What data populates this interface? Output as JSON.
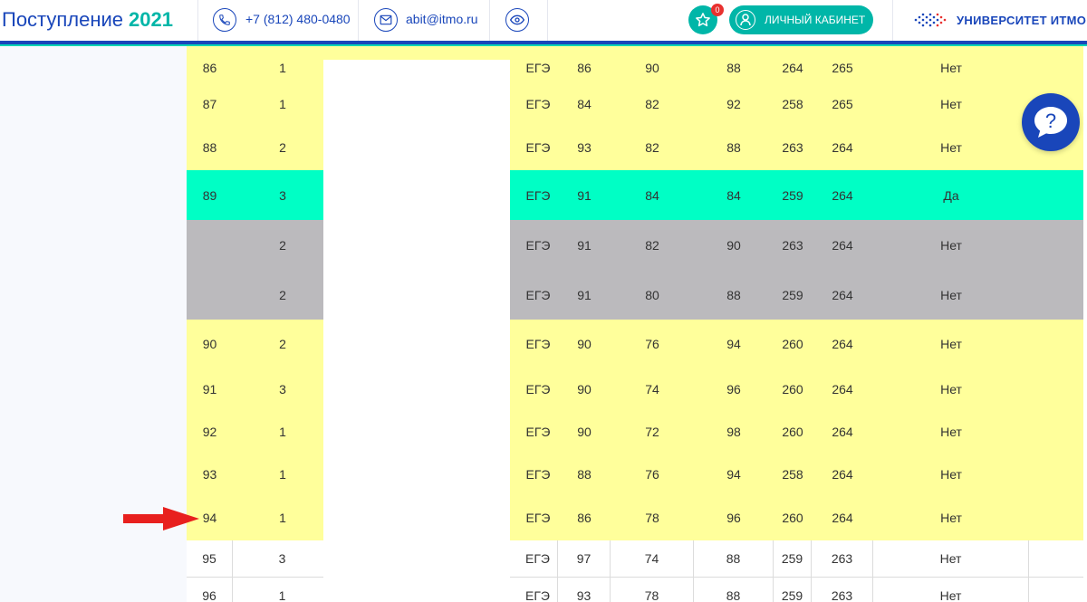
{
  "header": {
    "brand_title": "Поступление",
    "brand_year": "2021",
    "phone": "+7 (812) 480-0480",
    "email": "abit@itmo.ru",
    "favorites_count": "0",
    "cabinet_label": "ЛИЧНЫЙ КАБИНЕТ",
    "university_name": "УНИВЕРСИТЕТ ИТМО",
    "icons": [
      "phone-icon",
      "mail-icon",
      "eye-icon",
      "star-icon",
      "user-icon"
    ]
  },
  "colors": {
    "brand_blue": "#1946ba",
    "teal": "#00b6a8",
    "row_yellow": "#ffff9b",
    "row_green": "#00ffc5",
    "row_gray": "#bbbabd",
    "arrow_red": "#e8201e"
  },
  "table": {
    "rows": [
      {
        "style": "yellow",
        "num": "86",
        "prio": "1",
        "type": "ЕГЭ",
        "s1": "86",
        "s2": "90",
        "s3": "88",
        "sum": "264",
        "total": "265",
        "original": "Нет"
      },
      {
        "style": "yellow",
        "num": "87",
        "prio": "1",
        "type": "ЕГЭ",
        "s1": "84",
        "s2": "82",
        "s3": "92",
        "sum": "258",
        "total": "265",
        "original": "Нет"
      },
      {
        "style": "yellow",
        "num": "88",
        "prio": "2",
        "type": "ЕГЭ",
        "s1": "93",
        "s2": "82",
        "s3": "88",
        "sum": "263",
        "total": "264",
        "original": "Нет"
      },
      {
        "style": "green",
        "num": "89",
        "prio": "3",
        "type": "ЕГЭ",
        "s1": "91",
        "s2": "84",
        "s3": "84",
        "sum": "259",
        "total": "264",
        "original": "Да"
      },
      {
        "style": "gray",
        "num": "",
        "prio": "2",
        "type": "ЕГЭ",
        "s1": "91",
        "s2": "82",
        "s3": "90",
        "sum": "263",
        "total": "264",
        "original": "Нет"
      },
      {
        "style": "gray",
        "num": "",
        "prio": "2",
        "type": "ЕГЭ",
        "s1": "91",
        "s2": "80",
        "s3": "88",
        "sum": "259",
        "total": "264",
        "original": "Нет"
      },
      {
        "style": "yellow",
        "num": "90",
        "prio": "2",
        "type": "ЕГЭ",
        "s1": "90",
        "s2": "76",
        "s3": "94",
        "sum": "260",
        "total": "264",
        "original": "Нет"
      },
      {
        "style": "yellow",
        "num": "91",
        "prio": "3",
        "type": "ЕГЭ",
        "s1": "90",
        "s2": "74",
        "s3": "96",
        "sum": "260",
        "total": "264",
        "original": "Нет"
      },
      {
        "style": "yellow",
        "num": "92",
        "prio": "1",
        "type": "ЕГЭ",
        "s1": "90",
        "s2": "72",
        "s3": "98",
        "sum": "260",
        "total": "264",
        "original": "Нет"
      },
      {
        "style": "yellow",
        "num": "93",
        "prio": "1",
        "type": "ЕГЭ",
        "s1": "88",
        "s2": "76",
        "s3": "94",
        "sum": "258",
        "total": "264",
        "original": "Нет"
      },
      {
        "style": "yellow",
        "num": "94",
        "prio": "1",
        "type": "ЕГЭ",
        "s1": "86",
        "s2": "78",
        "s3": "96",
        "sum": "260",
        "total": "264",
        "original": "Нет"
      },
      {
        "style": "white",
        "num": "95",
        "prio": "3",
        "type": "ЕГЭ",
        "s1": "97",
        "s2": "74",
        "s3": "88",
        "sum": "259",
        "total": "263",
        "original": "Нет"
      },
      {
        "style": "white",
        "num": "96",
        "prio": "1",
        "type": "ЕГЭ",
        "s1": "93",
        "s2": "78",
        "s3": "88",
        "sum": "259",
        "total": "263",
        "original": "Нет"
      }
    ]
  },
  "help_label": "?"
}
